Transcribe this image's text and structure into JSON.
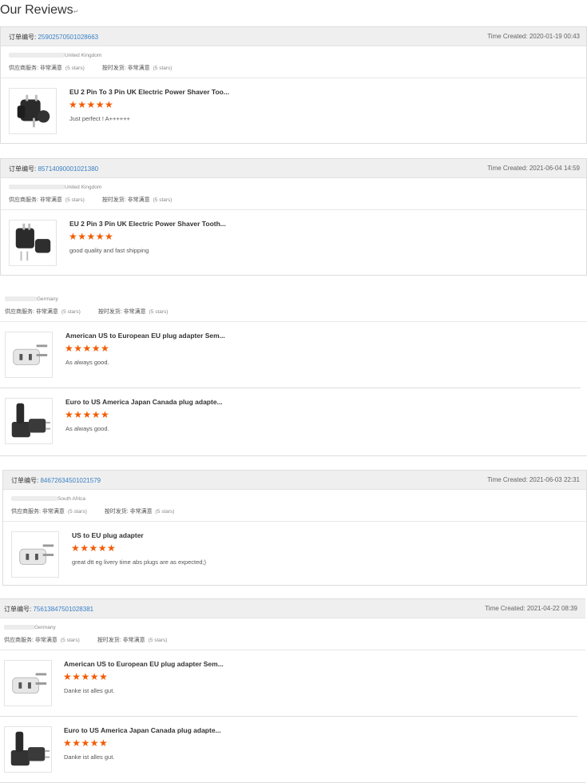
{
  "page": {
    "title": "Our Reviews",
    "title_mark": "↵"
  },
  "labels": {
    "order_no": "订单编号:",
    "time_created": "Time Created:",
    "supplier_service": "供应商服务:",
    "on_time": "按时发货:",
    "very_satisfied": "非常满意",
    "five_stars": "(5 stars)",
    "stars_glyph": "★★★★★"
  },
  "reviews": [
    {
      "order_id": "25902570501028663",
      "time": "2020-01-19 00:43",
      "country": "United Kingdom",
      "items": [
        {
          "title": "EU 2 Pin To 3 Pin UK Electric Power Shaver Too...",
          "comment": "Just perfect ! A++++++",
          "icon": "uk-plug-adapter-icon"
        }
      ]
    },
    {
      "order_id": "85714090001021380",
      "time": "2021-06-04 14:59",
      "country": "United Kingdom",
      "items": [
        {
          "title": "EU 2 Pin 3 Pin UK Electric Power Shaver Tooth...",
          "comment": "good quality and fast shipping",
          "icon": "uk-plug-adapter-icon"
        }
      ]
    },
    {
      "order_id": "",
      "time": "",
      "country": "Germany",
      "items": [
        {
          "title": "American US to European EU plug adapter Sem...",
          "comment": "As always good.",
          "icon": "eu-plug-adapter-icon"
        },
        {
          "title": "Euro to US America Japan Canada plug adapte...",
          "comment": "As always good.",
          "icon": "us-plug-adapter-icon"
        }
      ]
    },
    {
      "order_id": "84672634501021579",
      "time": "2021-06-03 22:31",
      "country": "South Africa",
      "items": [
        {
          "title": "US to EU plug adapter",
          "comment": "great dtt eg livery time abs plugs are as expected;)",
          "icon": "eu-plug-adapter-icon"
        }
      ]
    },
    {
      "order_id": "75613847501028381",
      "time": "2021-04-22 08:39",
      "country": "Germany",
      "items": [
        {
          "title": "American US to European EU plug adapter Sem...",
          "comment": "Danke ist alles gut.",
          "icon": "eu-plug-adapter-icon"
        },
        {
          "title": "Euro to US America Japan Canada plug adapte...",
          "comment": "Danke ist alles gut.",
          "icon": "us-plug-adapter-icon"
        }
      ]
    }
  ]
}
